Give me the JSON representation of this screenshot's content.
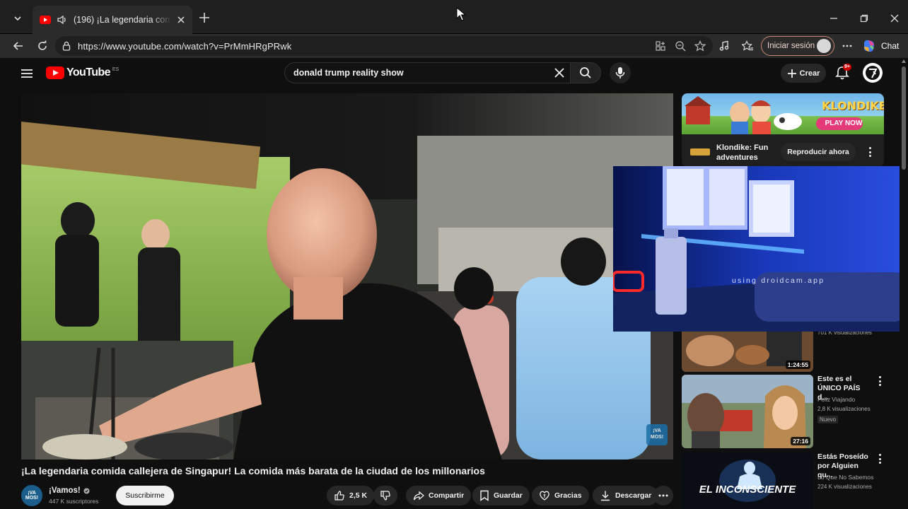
{
  "browser": {
    "tab": {
      "title": "(196) ¡La legendaria comida c",
      "favicon": "youtube-favicon",
      "audio_icon": "speaker-icon"
    },
    "address": {
      "url": "https://www.youtube.com/watch?v=PrMmHRgPRwk"
    },
    "signin_label": "Iniciar sesión",
    "chat_label": "Chat",
    "colors": {
      "tab_bg": "#2b2b2b",
      "chrome_bg": "#1f1f1f",
      "signin_border": "#c98577"
    }
  },
  "youtube": {
    "logo_text": "YouTube",
    "logo_region": "ES",
    "search_query": "donald trump reality show",
    "create_label": "Crear",
    "notifications_badge": "9+",
    "accent": "#ff0000"
  },
  "video": {
    "title": "¡La legendaria comida callejera de Singapur! La comida más barata de la ciudad de los millonarios",
    "channel": {
      "name": "¡Vamos!",
      "subscribers": "447 K suscriptores",
      "avatar_text": "¡VA MOS!"
    },
    "subscribe_label": "Suscribirme",
    "actions": {
      "likes": "2,5 K",
      "share": "Compartir",
      "save": "Guardar",
      "thanks": "Gracias",
      "download": "Descargar"
    },
    "watermark": "¡VA MOS!"
  },
  "sidebar": {
    "ad": {
      "brand": "KLONDIKE",
      "banner_cta": "PLAY NOW",
      "title": "Klondike: Fun adventures",
      "cta": "Reproducir ahora"
    },
    "recommendations": [
      {
        "views": "701 K visualizaciones",
        "duration": "1:24:55"
      },
      {
        "title": "Este es el ÚNICO PAÍS d...",
        "channel": "Feliz Viajando",
        "views": "2,8 K visualizaciones",
        "badge": "Nuevo",
        "duration": "27:16"
      },
      {
        "title": "Estás Poseído por Alguien qu...",
        "channel": "Lo Que No Sabemos",
        "views": "224 K visualizaciones",
        "thumb_text": "EL INCONSCIENTE"
      }
    ]
  },
  "overlay": {
    "caption": "using droidcam.app"
  }
}
